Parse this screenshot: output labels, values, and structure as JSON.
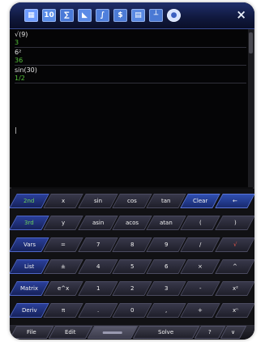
{
  "toolbar": {
    "icons": [
      {
        "name": "calculator-icon",
        "glyph": "▦",
        "color": "#6f9cff"
      },
      {
        "name": "numbers-icon",
        "glyph": "10",
        "color": "#5a8de8"
      },
      {
        "name": "equation-icon",
        "glyph": "∑",
        "color": "#4a7ad8"
      },
      {
        "name": "graph-icon",
        "glyph": "◣",
        "color": "#5b8be6"
      },
      {
        "name": "function-plot-icon",
        "glyph": "∫",
        "color": "#4f7fdc"
      },
      {
        "name": "currency-icon",
        "glyph": "$",
        "color": "#4c7bd6"
      },
      {
        "name": "matrix-icon",
        "glyph": "▤",
        "color": "#5a89e2"
      },
      {
        "name": "stats-icon",
        "glyph": "┴",
        "color": "#4a79d4"
      },
      {
        "name": "globe-icon",
        "glyph": "●",
        "color": "#d8e4ff"
      }
    ],
    "close_label": "×"
  },
  "history": [
    {
      "expr": "√(9)",
      "result": "3"
    },
    {
      "expr": "6²",
      "result": "36"
    },
    {
      "expr": "sin(30)",
      "result": "1/2"
    }
  ],
  "cursor": "|",
  "keypad": {
    "rows": [
      [
        {
          "label": "2nd",
          "style": "ctrl green"
        },
        {
          "label": "x"
        },
        {
          "label": "sin"
        },
        {
          "label": "cos"
        },
        {
          "label": "tan"
        },
        {
          "label": "Clear",
          "style": "ctrl2"
        },
        {
          "label": "←",
          "style": "ctrl2"
        }
      ],
      [
        {
          "label": "3rd",
          "style": "ctrl green"
        },
        {
          "label": "y"
        },
        {
          "label": "asin"
        },
        {
          "label": "acos"
        },
        {
          "label": "atan"
        },
        {
          "label": "("
        },
        {
          "label": ")"
        }
      ],
      [
        {
          "label": "Vars",
          "style": "ctrl"
        },
        {
          "label": "="
        },
        {
          "label": "7"
        },
        {
          "label": "8"
        },
        {
          "label": "9"
        },
        {
          "label": "/"
        },
        {
          "label": "√",
          "style": "red"
        }
      ],
      [
        {
          "label": "List",
          "style": "ctrl"
        },
        {
          "label": "±"
        },
        {
          "label": "4"
        },
        {
          "label": "5"
        },
        {
          "label": "6"
        },
        {
          "label": "×"
        },
        {
          "label": "^"
        }
      ],
      [
        {
          "label": "Matrix",
          "style": "ctrl"
        },
        {
          "label": "e^x"
        },
        {
          "label": "1"
        },
        {
          "label": "2"
        },
        {
          "label": "3"
        },
        {
          "label": "-"
        },
        {
          "label": "x²"
        }
      ],
      [
        {
          "label": "Deriv",
          "style": "ctrl"
        },
        {
          "label": "π"
        },
        {
          "label": "."
        },
        {
          "label": "0"
        },
        {
          "label": ","
        },
        {
          "label": "+"
        },
        {
          "label": "xⁿ"
        }
      ]
    ]
  },
  "menubar": {
    "file": "File",
    "edit": "Edit",
    "solve": "Solve",
    "help": "?",
    "more": "∨"
  }
}
